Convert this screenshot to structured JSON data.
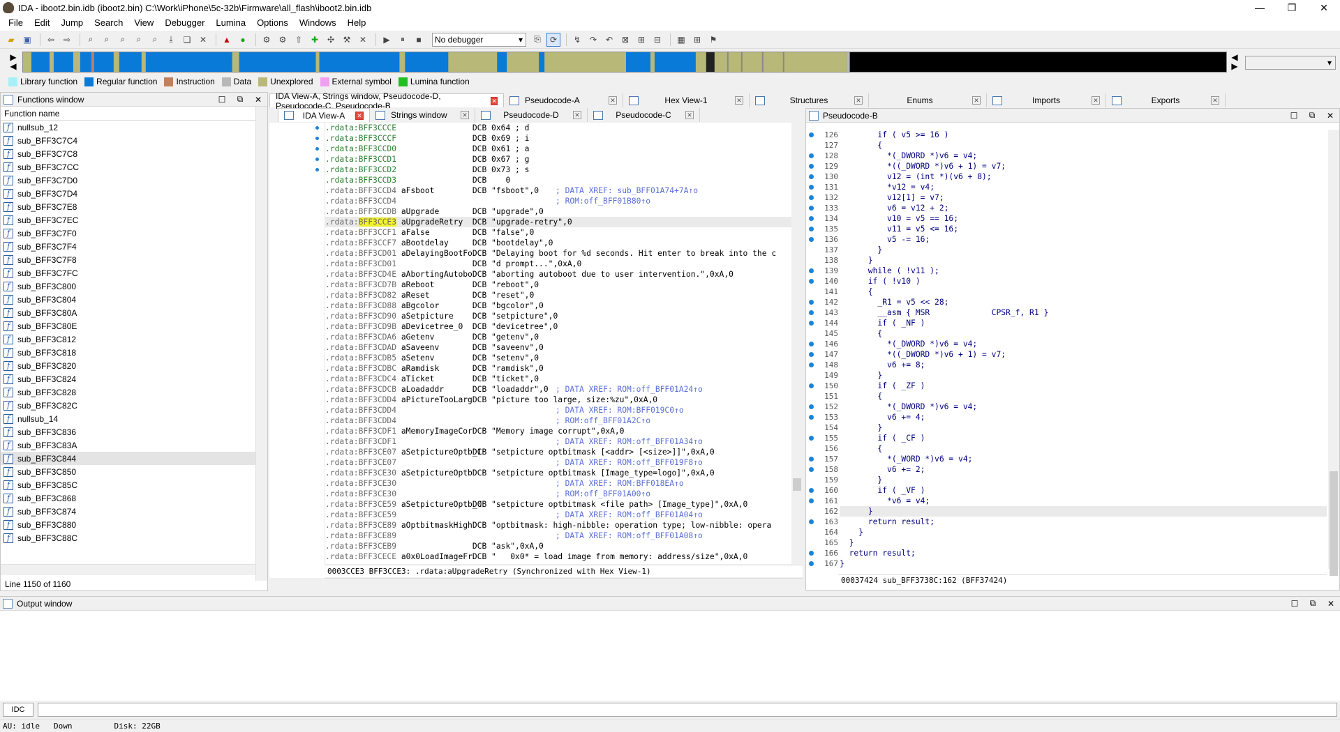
{
  "window": {
    "title": "IDA - iboot2.bin.idb (iboot2.bin) C:\\Work\\iPhone\\5c-32b\\Firmware\\all_flash\\iboot2.bin.idb"
  },
  "menu": [
    "File",
    "Edit",
    "Jump",
    "Search",
    "View",
    "Debugger",
    "Lumina",
    "Options",
    "Windows",
    "Help"
  ],
  "toolbar": {
    "debugger_select": "No debugger"
  },
  "legend": [
    {
      "label": "Library function",
      "color": "#a8f0f8"
    },
    {
      "label": "Regular function",
      "color": "#0a7ad8"
    },
    {
      "label": "Instruction",
      "color": "#c08060"
    },
    {
      "label": "Data",
      "color": "#b8b8b8"
    },
    {
      "label": "Unexplored",
      "color": "#b8b878"
    },
    {
      "label": "External symbol",
      "color": "#f0a0f0"
    },
    {
      "label": "Lumina function",
      "color": "#20c020"
    }
  ],
  "functions": {
    "title": "Functions window",
    "column": "Function name",
    "items": [
      "nullsub_12",
      "sub_BFF3C7C4",
      "sub_BFF3C7C8",
      "sub_BFF3C7CC",
      "sub_BFF3C7D0",
      "sub_BFF3C7D4",
      "sub_BFF3C7E8",
      "sub_BFF3C7EC",
      "sub_BFF3C7F0",
      "sub_BFF3C7F4",
      "sub_BFF3C7F8",
      "sub_BFF3C7FC",
      "sub_BFF3C800",
      "sub_BFF3C804",
      "sub_BFF3C80A",
      "sub_BFF3C80E",
      "sub_BFF3C812",
      "sub_BFF3C818",
      "sub_BFF3C820",
      "sub_BFF3C824",
      "sub_BFF3C828",
      "sub_BFF3C82C",
      "nullsub_14",
      "sub_BFF3C836",
      "sub_BFF3C83A",
      "sub_BFF3C844",
      "sub_BFF3C850",
      "sub_BFF3C85C",
      "sub_BFF3C868",
      "sub_BFF3C874",
      "sub_BFF3C880",
      "sub_BFF3C88C"
    ],
    "status": "Line 1150 of 1160"
  },
  "tabs": {
    "main": [
      {
        "label": "IDA View-A, Strings window, Pseudocode-D, Pseudocode-C, Pseudocode-B"
      },
      {
        "label": "Pseudocode-A"
      },
      {
        "label": "Hex View-1"
      },
      {
        "label": "Structures"
      },
      {
        "label": "Enums"
      },
      {
        "label": "Imports"
      },
      {
        "label": "Exports"
      }
    ],
    "sub": [
      {
        "label": "IDA View-A"
      },
      {
        "label": "Strings window"
      },
      {
        "label": "Pseudocode-D"
      },
      {
        "label": "Pseudocode-C"
      }
    ]
  },
  "disasm": {
    "lines": [
      {
        "seg": ".rdata:",
        "addr": "BFF3CCCE",
        "name": "",
        "body": "DCB 0x64 ; d"
      },
      {
        "seg": ".rdata:",
        "addr": "BFF3CCCF",
        "name": "",
        "body": "DCB 0x69 ; i"
      },
      {
        "seg": ".rdata:",
        "addr": "BFF3CCD0",
        "name": "",
        "body": "DCB 0x61 ; a"
      },
      {
        "seg": ".rdata:",
        "addr": "BFF3CCD1",
        "name": "",
        "body": "DCB 0x67 ; g"
      },
      {
        "seg": ".rdata:",
        "addr": "BFF3CCD2",
        "name": "",
        "body": "DCB 0x73 ; s"
      },
      {
        "seg": ".rdata:",
        "addr": "BFF3CCD3",
        "name": "",
        "body": "DCB    0"
      },
      {
        "seg": ".rdata:",
        "addr": "BFF3CCD4",
        "name": "aFsboot",
        "body": "DCB \"fsboot\",0",
        "cmt": "; DATA XREF: sub_BFF01A74+7A↑o"
      },
      {
        "seg": ".rdata:",
        "addr": "BFF3CCD4",
        "name": "",
        "body": "",
        "cmt": "; ROM:off_BFF01B80↑o"
      },
      {
        "seg": ".rdata:",
        "addr": "BFF3CCDB",
        "name": "aUpgrade",
        "body": "DCB \"upgrade\",0"
      },
      {
        "seg": ".rdata:",
        "addr": "BFF3CCE3",
        "name": "aUpgradeRetry",
        "body": "DCB \"upgrade-retry\",0",
        "cur": true
      },
      {
        "seg": ".rdata:",
        "addr": "BFF3CCF1",
        "name": "aFalse",
        "body": "DCB \"false\",0"
      },
      {
        "seg": ".rdata:",
        "addr": "BFF3CCF7",
        "name": "aBootdelay",
        "body": "DCB \"bootdelay\",0"
      },
      {
        "seg": ".rdata:",
        "addr": "BFF3CD01",
        "name": "aDelayingBootFo",
        "body": "DCB \"Delaying boot for %d seconds. Hit enter to break into the c"
      },
      {
        "seg": ".rdata:",
        "addr": "BFF3CD01",
        "name": "",
        "body": "DCB \"d prompt...\",0xA,0"
      },
      {
        "seg": ".rdata:",
        "addr": "BFF3CD4E",
        "name": "aAbortingAutobo",
        "body": "DCB \"aborting autoboot due to user intervention.\",0xA,0"
      },
      {
        "seg": ".rdata:",
        "addr": "BFF3CD7B",
        "name": "aReboot",
        "body": "DCB \"reboot\",0"
      },
      {
        "seg": ".rdata:",
        "addr": "BFF3CD82",
        "name": "aReset",
        "body": "DCB \"reset\",0"
      },
      {
        "seg": ".rdata:",
        "addr": "BFF3CD88",
        "name": "aBgcolor",
        "body": "DCB \"bgcolor\",0"
      },
      {
        "seg": ".rdata:",
        "addr": "BFF3CD90",
        "name": "aSetpicture",
        "body": "DCB \"setpicture\",0"
      },
      {
        "seg": ".rdata:",
        "addr": "BFF3CD9B",
        "name": "aDevicetree_0",
        "body": "DCB \"devicetree\",0"
      },
      {
        "seg": ".rdata:",
        "addr": "BFF3CDA6",
        "name": "aGetenv",
        "body": "DCB \"getenv\",0"
      },
      {
        "seg": ".rdata:",
        "addr": "BFF3CDAD",
        "name": "aSaveenv",
        "body": "DCB \"saveenv\",0"
      },
      {
        "seg": ".rdata:",
        "addr": "BFF3CDB5",
        "name": "aSetenv",
        "body": "DCB \"setenv\",0"
      },
      {
        "seg": ".rdata:",
        "addr": "BFF3CDBC",
        "name": "aRamdisk",
        "body": "DCB \"ramdisk\",0"
      },
      {
        "seg": ".rdata:",
        "addr": "BFF3CDC4",
        "name": "aTicket",
        "body": "DCB \"ticket\",0"
      },
      {
        "seg": ".rdata:",
        "addr": "BFF3CDCB",
        "name": "aLoadaddr",
        "body": "DCB \"loadaddr\",0",
        "cmt": "; DATA XREF: ROM:off_BFF01A24↑o"
      },
      {
        "seg": ".rdata:",
        "addr": "BFF3CDD4",
        "name": "aPictureTooLarg",
        "body": "DCB \"picture too large, size:%zu\",0xA,0"
      },
      {
        "seg": ".rdata:",
        "addr": "BFF3CDD4",
        "name": "",
        "body": "",
        "cmt": "; DATA XREF: ROM:BFF019C0↑o"
      },
      {
        "seg": ".rdata:",
        "addr": "BFF3CDD4",
        "name": "",
        "body": "",
        "cmt": "; ROM:off_BFF01A2C↑o"
      },
      {
        "seg": ".rdata:",
        "addr": "BFF3CDF1",
        "name": "aMemoryImageCor",
        "body": "DCB \"Memory image corrupt\",0xA,0"
      },
      {
        "seg": ".rdata:",
        "addr": "BFF3CDF1",
        "name": "",
        "body": "",
        "cmt": "; DATA XREF: ROM:off_BFF01A34↑o"
      },
      {
        "seg": ".rdata:",
        "addr": "BFF3CE07",
        "name": "aSetpictureOptb_1",
        "body": "DCB \"setpicture optbitmask [<addr> [<size>]]\",0xA,0"
      },
      {
        "seg": ".rdata:",
        "addr": "BFF3CE07",
        "name": "",
        "body": "",
        "cmt": "; DATA XREF: ROM:off_BFF019F8↑o"
      },
      {
        "seg": ".rdata:",
        "addr": "BFF3CE30",
        "name": "aSetpictureOptb",
        "body": "DCB \"setpicture optbitmask [Image_type=logo]\",0xA,0"
      },
      {
        "seg": ".rdata:",
        "addr": "BFF3CE30",
        "name": "",
        "body": "",
        "cmt": "; DATA XREF: ROM:BFF018EA↑o"
      },
      {
        "seg": ".rdata:",
        "addr": "BFF3CE30",
        "name": "",
        "body": "",
        "cmt": "; ROM:off_BFF01A00↑o"
      },
      {
        "seg": ".rdata:",
        "addr": "BFF3CE59",
        "name": "aSetpictureOptb_0",
        "body": "DCB \"setpicture optbitmask <file path> [Image_type]\",0xA,0"
      },
      {
        "seg": ".rdata:",
        "addr": "BFF3CE59",
        "name": "",
        "body": "",
        "cmt": "; DATA XREF: ROM:off_BFF01A04↑o"
      },
      {
        "seg": ".rdata:",
        "addr": "BFF3CE89",
        "name": "aOptbitmaskHigh",
        "body": "DCB \"optbitmask: high-nibble: operation type; low-nibble: opera"
      },
      {
        "seg": ".rdata:",
        "addr": "BFF3CE89",
        "name": "",
        "body": "",
        "cmt": "; DATA XREF: ROM:off_BFF01A08↑o"
      },
      {
        "seg": ".rdata:",
        "addr": "BFF3CEB9",
        "name": "",
        "body": "DCB \"ask\",0xA,0"
      },
      {
        "seg": ".rdata:",
        "addr": "BFF3CECE",
        "name": "a0x0LoadImageFr",
        "body": "DCB \"   0x0* = load image from memory: address/size\",0xA,0"
      }
    ],
    "status": "0003CCE3 BFF3CCE3: .rdata:aUpgradeRetry (Synchronized with Hex View-1)"
  },
  "pseudo": {
    "title": "Pseudocode-B",
    "lines": [
      {
        "n": "126",
        "dot": true,
        "code": "        if ( v5 >= 16 )"
      },
      {
        "n": "127",
        "dot": false,
        "code": "        {"
      },
      {
        "n": "128",
        "dot": true,
        "code": "          *(_DWORD *)v6 = v4;"
      },
      {
        "n": "129",
        "dot": true,
        "code": "          *((_DWORD *)v6 + 1) = v7;"
      },
      {
        "n": "130",
        "dot": true,
        "code": "          v12 = (int *)(v6 + 8);"
      },
      {
        "n": "131",
        "dot": true,
        "code": "          *v12 = v4;"
      },
      {
        "n": "132",
        "dot": true,
        "code": "          v12[1] = v7;"
      },
      {
        "n": "133",
        "dot": true,
        "code": "          v6 = v12 + 2;"
      },
      {
        "n": "134",
        "dot": true,
        "code": "          v10 = v5 == 16;"
      },
      {
        "n": "135",
        "dot": true,
        "code": "          v11 = v5 <= 16;"
      },
      {
        "n": "136",
        "dot": true,
        "code": "          v5 -= 16;"
      },
      {
        "n": "137",
        "dot": false,
        "code": "        }"
      },
      {
        "n": "138",
        "dot": false,
        "code": "      }"
      },
      {
        "n": "139",
        "dot": true,
        "code": "      while ( !v11 );"
      },
      {
        "n": "140",
        "dot": true,
        "code": "      if ( !v10 )"
      },
      {
        "n": "141",
        "dot": false,
        "code": "      {"
      },
      {
        "n": "142",
        "dot": true,
        "code": "        _R1 = v5 << 28;"
      },
      {
        "n": "143",
        "dot": true,
        "code": "        __asm { MSR             CPSR_f, R1 }"
      },
      {
        "n": "144",
        "dot": true,
        "code": "        if ( _NF )"
      },
      {
        "n": "145",
        "dot": false,
        "code": "        {"
      },
      {
        "n": "146",
        "dot": true,
        "code": "          *(_DWORD *)v6 = v4;"
      },
      {
        "n": "147",
        "dot": true,
        "code": "          *((_DWORD *)v6 + 1) = v7;"
      },
      {
        "n": "148",
        "dot": true,
        "code": "          v6 += 8;"
      },
      {
        "n": "149",
        "dot": false,
        "code": "        }"
      },
      {
        "n": "150",
        "dot": true,
        "code": "        if ( _ZF )"
      },
      {
        "n": "151",
        "dot": false,
        "code": "        {"
      },
      {
        "n": "152",
        "dot": true,
        "code": "          *(_DWORD *)v6 = v4;"
      },
      {
        "n": "153",
        "dot": true,
        "code": "          v6 += 4;"
      },
      {
        "n": "154",
        "dot": false,
        "code": "        }"
      },
      {
        "n": "155",
        "dot": true,
        "code": "        if ( _CF )"
      },
      {
        "n": "156",
        "dot": false,
        "code": "        {"
      },
      {
        "n": "157",
        "dot": true,
        "code": "          *(_WORD *)v6 = v4;"
      },
      {
        "n": "158",
        "dot": true,
        "code": "          v6 += 2;"
      },
      {
        "n": "159",
        "dot": false,
        "code": "        }"
      },
      {
        "n": "160",
        "dot": true,
        "code": "        if ( _VF )"
      },
      {
        "n": "161",
        "dot": true,
        "code": "          *v6 = v4;"
      },
      {
        "n": "162",
        "dot": false,
        "code": "      }",
        "cur": true
      },
      {
        "n": "163",
        "dot": true,
        "code": "      return result;"
      },
      {
        "n": "164",
        "dot": false,
        "code": "    }"
      },
      {
        "n": "165",
        "dot": false,
        "code": "  }"
      },
      {
        "n": "166",
        "dot": true,
        "code": "  return result;"
      },
      {
        "n": "167",
        "dot": true,
        "code": "}"
      }
    ],
    "status": "00037424 sub_BFF3738C:162 (BFF37424)"
  },
  "output": {
    "title": "Output window",
    "idc_label": "IDC"
  },
  "statusbar": {
    "au": "AU:  idle",
    "dir": "Down",
    "disk": "Disk: 22GB"
  }
}
